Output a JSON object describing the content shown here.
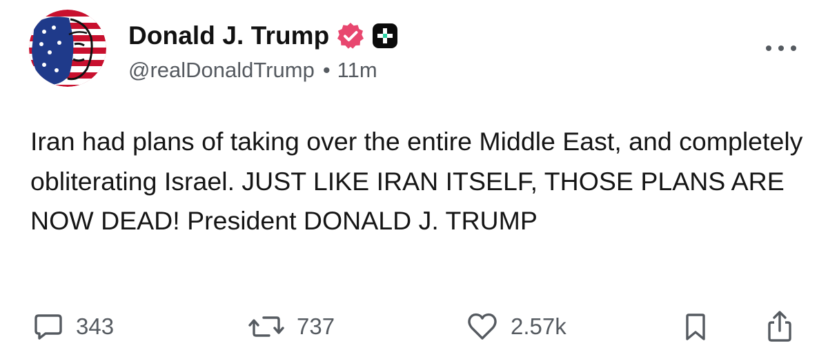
{
  "post": {
    "author": {
      "display_name": "Donald J. Trump",
      "handle": "@realDonaldTrump",
      "separator": "•",
      "time": "11m",
      "verified_badge": "verified-badge-icon",
      "verified_color": "#e8476f",
      "plus_badge": "plus-badge-icon"
    },
    "text": "Iran had plans of taking over the entire Middle East, and completely obliterating Israel. JUST LIKE IRAN ITSELF, THOSE PLANS ARE NOW DEAD! President DONALD J. TRUMP",
    "actions": {
      "replies": "343",
      "reposts": "737",
      "likes": "2.57k"
    },
    "icons": {
      "reply": "comment-icon",
      "repost": "repost-icon",
      "like": "heart-icon",
      "bookmark": "bookmark-icon",
      "share": "share-icon",
      "more": "more-options-icon"
    },
    "colors": {
      "text": "#151515",
      "muted": "#555a60",
      "background": "#ffffff"
    }
  }
}
